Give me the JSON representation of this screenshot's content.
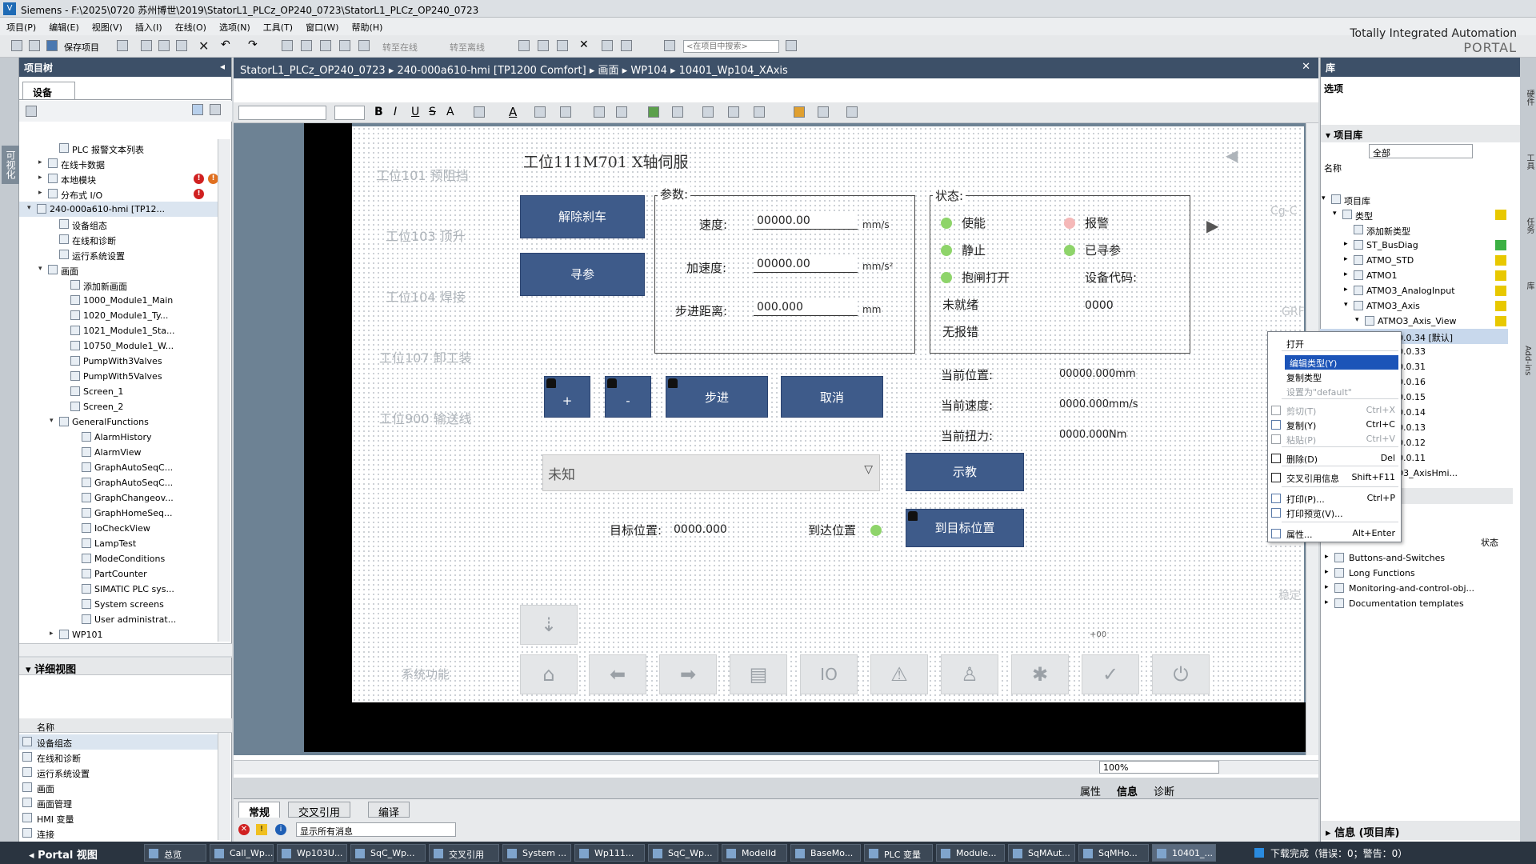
{
  "window": {
    "app": "Siemens",
    "path": "F:\\2025\\0720 苏州博世\\2019\\StatorL1_PLCz_OP240_0723\\StatorL1_PLCz_OP240_0723"
  },
  "brand": {
    "line1": "Totally Integrated Automation",
    "line2": "PORTAL"
  },
  "menu": [
    "项目(P)",
    "编辑(E)",
    "视图(V)",
    "插入(I)",
    "在线(O)",
    "选项(N)",
    "工具(T)",
    "窗口(W)",
    "帮助(H)"
  ],
  "toolbar": {
    "save_label": "保存项目",
    "online_label": "转至在线",
    "offline_label": "转至离线",
    "search_placeholder": "<在项目中搜索>"
  },
  "left_strip": {
    "label": "可视化"
  },
  "project_tree": {
    "title": "项目树",
    "tab": "设备",
    "items": [
      {
        "label": "PLC 报警文本列表",
        "indent": 3
      },
      {
        "label": "在线卡数据",
        "indent": 2,
        "arrow": "▸"
      },
      {
        "label": "本地模块",
        "indent": 2,
        "arrow": "▸",
        "errors": 2
      },
      {
        "label": "分布式 I/O",
        "indent": 2,
        "arrow": "▸",
        "errors": 1
      },
      {
        "label": "240-000a610-hmi [TP12...",
        "indent": 1,
        "arrow": "▾",
        "selected": true
      },
      {
        "label": "设备组态",
        "indent": 3
      },
      {
        "label": "在线和诊断",
        "indent": 3
      },
      {
        "label": "运行系统设置",
        "indent": 3
      },
      {
        "label": "画面",
        "indent": 2,
        "arrow": "▾"
      },
      {
        "label": "添加新画面",
        "indent": 4
      },
      {
        "label": "1000_Module1_Main",
        "indent": 4
      },
      {
        "label": "1020_Module1_Ty...",
        "indent": 4
      },
      {
        "label": "1021_Module1_Sta...",
        "indent": 4
      },
      {
        "label": "10750_Module1_W...",
        "indent": 4
      },
      {
        "label": "PumpWith3Valves",
        "indent": 4
      },
      {
        "label": "PumpWith5Valves",
        "indent": 4
      },
      {
        "label": "Screen_1",
        "indent": 4
      },
      {
        "label": "Screen_2",
        "indent": 4
      },
      {
        "label": "GeneralFunctions",
        "indent": 3,
        "arrow": "▾"
      },
      {
        "label": "AlarmHistory",
        "indent": 5
      },
      {
        "label": "AlarmView",
        "indent": 5
      },
      {
        "label": "GraphAutoSeqC...",
        "indent": 5
      },
      {
        "label": "GraphAutoSeqC...",
        "indent": 5
      },
      {
        "label": "GraphChangeov...",
        "indent": 5
      },
      {
        "label": "GraphHomeSeq...",
        "indent": 5
      },
      {
        "label": "IoCheckView",
        "indent": 5
      },
      {
        "label": "LampTest",
        "indent": 5
      },
      {
        "label": "ModeConditions",
        "indent": 5
      },
      {
        "label": "PartCounter",
        "indent": 5
      },
      {
        "label": "SIMATIC PLC sys...",
        "indent": 5
      },
      {
        "label": "System screens",
        "indent": 5
      },
      {
        "label": "User administrat...",
        "indent": 5
      },
      {
        "label": "WP101",
        "indent": 3,
        "arrow": "▸"
      }
    ]
  },
  "detail_view": {
    "title": "详细视图",
    "col_name": "名称",
    "items": [
      "设备组态",
      "在线和诊断",
      "运行系统设置",
      "画面",
      "画面管理",
      "HMI 变量",
      "连接"
    ]
  },
  "editor": {
    "breadcrumb": [
      "StatorL1_PLCz_OP240_0723",
      "240-000a610-hmi [TP1200 Comfort]",
      "画面",
      "WP104",
      "10401_Wp104_XAxis"
    ],
    "zoom": "100%"
  },
  "hmi": {
    "title": "工位111M701  X轴伺服",
    "nav": [
      "工位101  预阻挡",
      "工位103  顶升",
      "工位104  焊接",
      "工位107  卸工装",
      "工位900  输送线"
    ],
    "btn_release_brake": "解除刹车",
    "btn_home": "寻参",
    "params_label": "参数:",
    "speed_label": "速度:",
    "speed_value": "00000.00",
    "speed_unit": "mm/s",
    "accel_label": "加速度:",
    "accel_value": "00000.00",
    "accel_unit": "mm/s²",
    "step_label": "步进距离:",
    "step_value": "000.000",
    "step_unit": "mm",
    "status_label": "状态:",
    "st_enable": "使能",
    "st_alarm": "报警",
    "st_still": "静止",
    "st_homed": "已寻参",
    "st_brake": "抱闸打开",
    "st_devcode_label": "设备代码:",
    "st_notready": "未就绪",
    "st_devcode_value": "0000",
    "st_noerr": "无报错",
    "btn_plus": "+",
    "btn_minus": "-",
    "btn_step": "步进",
    "btn_cancel": "取消",
    "cur_pos_label": "当前位置:",
    "cur_pos_value": "00000.000mm",
    "cur_speed_label": "当前速度:",
    "cur_speed_value": "0000.000mm/s",
    "cur_torque_label": "当前扭力:",
    "cur_torque_value": "0000.000Nm",
    "combo_value": "未知",
    "btn_teach": "示教",
    "target_label": "目标位置:",
    "target_value": "0000.000",
    "reached_label": "到达位置",
    "btn_goto": "到目标位置",
    "sys_label": "系统功能",
    "small_text": "+00",
    "right_frag1": "Cg-C",
    "right_frag2": "GRF",
    "right_frag3": "稳定"
  },
  "library": {
    "title": "库",
    "options": "选项",
    "project_lib": "项目库",
    "filter": "全部",
    "col_name": "名称",
    "items": [
      {
        "label": "项目库",
        "indent": 0,
        "arrow": "▾"
      },
      {
        "label": "类型",
        "indent": 1,
        "arrow": "▾",
        "stat": "y"
      },
      {
        "label": "添加新类型",
        "indent": 2
      },
      {
        "label": "ST_BusDiag",
        "indent": 2,
        "arrow": "▸",
        "stat": "g"
      },
      {
        "label": "ATMO_STD",
        "indent": 2,
        "arrow": "▸",
        "stat": "y"
      },
      {
        "label": "ATMO1",
        "indent": 2,
        "arrow": "▸",
        "stat": "y"
      },
      {
        "label": "ATMO3_AnalogInput",
        "indent": 2,
        "arrow": "▸",
        "stat": "y"
      },
      {
        "label": "ATMO3_Axis",
        "indent": 2,
        "arrow": "▾",
        "stat": "y"
      },
      {
        "label": "ATMO3_Axis_View",
        "indent": 3,
        "arrow": "▾",
        "stat": "y"
      },
      {
        "label": "V 0.0.34 [默认]",
        "indent": 4,
        "selected": true
      },
      {
        "label": "V 0.0.33",
        "indent": 4
      },
      {
        "label": "V 0.0.31",
        "indent": 4
      },
      {
        "label": "V 0.0.16",
        "indent": 4
      },
      {
        "label": "V 0.0.15",
        "indent": 4
      },
      {
        "label": "V 0.0.14",
        "indent": 4
      },
      {
        "label": "V 0.0.13",
        "indent": 4
      },
      {
        "label": "V 0.0.12",
        "indent": 4
      },
      {
        "label": "V 0.0.11",
        "indent": 4
      },
      {
        "label": "MO3_AxisHmi...",
        "indent": 4
      }
    ],
    "global_col_status": "状态",
    "global_items": [
      "Buttons-and-Switches",
      "Long Functions",
      "Monitoring-and-control-obj...",
      "Documentation templates"
    ],
    "info_title": "信息 (项目库)"
  },
  "context_menu": [
    {
      "label": "打开",
      "shortcut": ""
    },
    {
      "label": "编辑类型(Y)",
      "shortcut": "",
      "highlight": true
    },
    {
      "label": "复制类型",
      "shortcut": ""
    },
    {
      "label": "设置为\"default\"",
      "shortcut": "",
      "disabled": true
    },
    {
      "label": "剪切(T)",
      "shortcut": "Ctrl+X",
      "disabled": true
    },
    {
      "label": "复制(Y)",
      "shortcut": "Ctrl+C"
    },
    {
      "label": "粘贴(P)",
      "shortcut": "Ctrl+V",
      "disabled": true
    },
    {
      "label": "删除(D)",
      "shortcut": "Del"
    },
    {
      "label": "交叉引用信息",
      "shortcut": "Shift+F11"
    },
    {
      "label": "打印(P)...",
      "shortcut": "Ctrl+P"
    },
    {
      "label": "打印预览(V)...",
      "shortcut": ""
    },
    {
      "label": "属性...",
      "shortcut": "Alt+Enter"
    }
  ],
  "inspector_tabs": [
    "属性",
    "信息",
    "诊断"
  ],
  "info_tabs": [
    "常规",
    "交叉引用",
    "编译"
  ],
  "info_filter": "显示所有消息",
  "taskbar": {
    "portal": "Portal 视图",
    "items": [
      "总览",
      "Call_Wp...",
      "Wp103U...",
      "SqC_Wp...",
      "交叉引用",
      "System ...",
      "Wp111...",
      "SqC_Wp...",
      "ModelId",
      "BaseMo...",
      "PLC 变量",
      "Module...",
      "SqMAut...",
      "SqMHo...",
      "10401_..."
    ],
    "status": "下载完成（错误：0；警告：0）"
  }
}
